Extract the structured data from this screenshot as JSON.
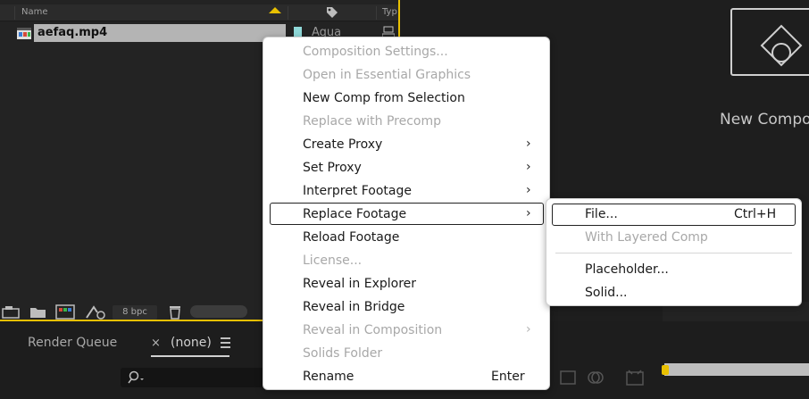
{
  "project_panel": {
    "col_name": "Name",
    "col_type": "Typ",
    "item": {
      "name": "aefaq.mp4",
      "label": "Aqua"
    },
    "bpc": "8 bpc"
  },
  "viewer": {
    "new_comp": "New Compos"
  },
  "timeline": {
    "render_queue_tab": "Render Queue",
    "close": "×",
    "comp_tab": "(none)"
  },
  "context_menu": {
    "items": [
      {
        "label": "Composition Settings...",
        "disabled": true
      },
      {
        "label": "Open in Essential Graphics",
        "disabled": true
      },
      {
        "label": "New Comp from Selection",
        "disabled": false
      },
      {
        "label": "Replace with Precomp",
        "disabled": true
      },
      {
        "label": "Create Proxy",
        "disabled": false,
        "submenu": true
      },
      {
        "label": "Set Proxy",
        "disabled": false,
        "submenu": true
      },
      {
        "label": "Interpret Footage",
        "disabled": false,
        "submenu": true
      },
      {
        "label": "Replace Footage",
        "disabled": false,
        "submenu": true,
        "highlighted": true
      },
      {
        "label": "Reload Footage",
        "disabled": false
      },
      {
        "label": "License...",
        "disabled": true
      },
      {
        "label": "Reveal in Explorer",
        "disabled": false
      },
      {
        "label": "Reveal in Bridge",
        "disabled": false
      },
      {
        "label": "Reveal in Composition",
        "disabled": true,
        "submenu": true
      },
      {
        "label": "Solids Folder",
        "disabled": true
      },
      {
        "label": "Rename",
        "disabled": false,
        "shortcut": "Enter"
      }
    ]
  },
  "replace_footage_submenu": {
    "items": [
      {
        "label": "File...",
        "shortcut": "Ctrl+H",
        "highlighted": true
      },
      {
        "label": "With Layered Comp",
        "disabled": true
      },
      {
        "label": "Placeholder..."
      },
      {
        "label": "Solid..."
      }
    ]
  },
  "colors": {
    "accent_yellow": "#e8c000",
    "panel_bg": "#232323",
    "menu_bg": "#ffffff",
    "label_aqua": "#8fd8d8"
  }
}
